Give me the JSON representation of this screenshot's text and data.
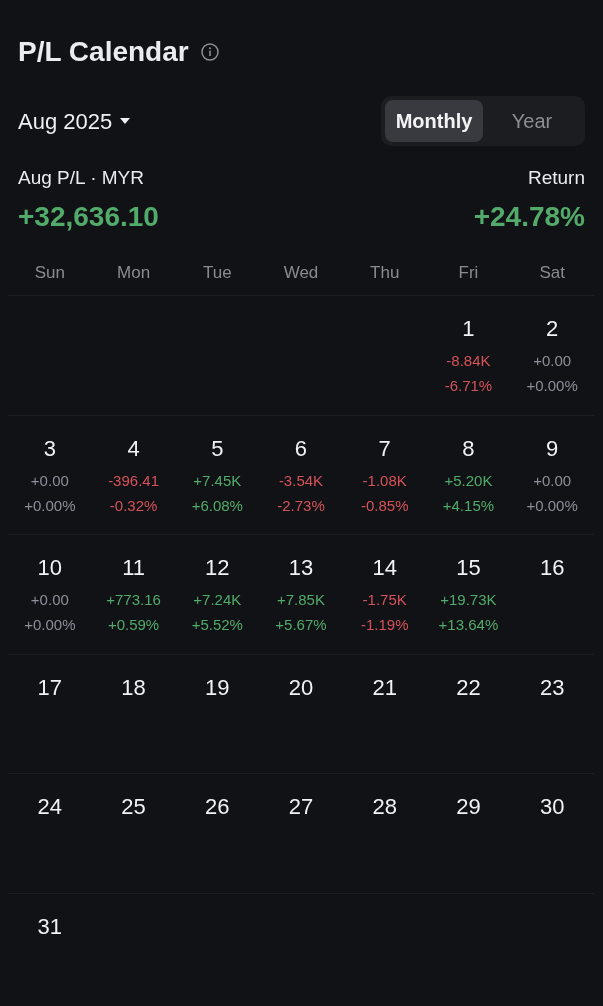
{
  "header": {
    "title": "P/L Calendar"
  },
  "period": {
    "label": "Aug 2025"
  },
  "view_tabs": [
    {
      "label": "Monthly",
      "selected": true
    },
    {
      "label": "Year",
      "selected": false
    }
  ],
  "summary": [
    {
      "label": "Aug P/L · MYR",
      "value": "+32,636.10",
      "color": "#52ab6b"
    },
    {
      "label": "Return",
      "value": "+24.78%",
      "color": "#52ab6b"
    }
  ],
  "weekdays": [
    "Sun",
    "Mon",
    "Tue",
    "Wed",
    "Thu",
    "Fri",
    "Sat"
  ],
  "weeks": [
    {
      "days": [
        {
          "kind": "blank"
        },
        {
          "kind": "blank"
        },
        {
          "kind": "blank"
        },
        {
          "kind": "blank"
        },
        {
          "kind": "blank"
        },
        {
          "kind": "day",
          "day": "1",
          "pl": "-8.84K",
          "return": "-6.71%",
          "color": "#d6525a"
        },
        {
          "kind": "day",
          "day": "2",
          "pl": "+0.00",
          "return": "+0.00%",
          "color": "#8b8f98"
        }
      ]
    },
    {
      "days": [
        {
          "kind": "day",
          "day": "3",
          "pl": "+0.00",
          "return": "+0.00%",
          "color": "#8b8f98"
        },
        {
          "kind": "day",
          "day": "4",
          "pl": "-396.41",
          "return": "-0.32%",
          "color": "#d6525a"
        },
        {
          "kind": "day",
          "day": "5",
          "pl": "+7.45K",
          "return": "+6.08%",
          "color": "#52ab6b"
        },
        {
          "kind": "day",
          "day": "6",
          "pl": "-3.54K",
          "return": "-2.73%",
          "color": "#d6525a"
        },
        {
          "kind": "day",
          "day": "7",
          "pl": "-1.08K",
          "return": "-0.85%",
          "color": "#d6525a"
        },
        {
          "kind": "day",
          "day": "8",
          "pl": "+5.20K",
          "return": "+4.15%",
          "color": "#52ab6b"
        },
        {
          "kind": "day",
          "day": "9",
          "pl": "+0.00",
          "return": "+0.00%",
          "color": "#8b8f98"
        }
      ]
    },
    {
      "days": [
        {
          "kind": "day",
          "day": "10",
          "pl": "+0.00",
          "return": "+0.00%",
          "color": "#8b8f98"
        },
        {
          "kind": "day",
          "day": "11",
          "pl": "+773.16",
          "return": "+0.59%",
          "color": "#52ab6b"
        },
        {
          "kind": "day",
          "day": "12",
          "pl": "+7.24K",
          "return": "+5.52%",
          "color": "#52ab6b"
        },
        {
          "kind": "day",
          "day": "13",
          "pl": "+7.85K",
          "return": "+5.67%",
          "color": "#52ab6b"
        },
        {
          "kind": "day",
          "day": "14",
          "pl": "-1.75K",
          "return": "-1.19%",
          "color": "#d6525a"
        },
        {
          "kind": "day",
          "day": "15",
          "pl": "+19.73K",
          "return": "+13.64%",
          "color": "#52ab6b"
        },
        {
          "kind": "day",
          "day": "16"
        }
      ]
    },
    {
      "days": [
        {
          "kind": "day",
          "day": "17"
        },
        {
          "kind": "day",
          "day": "18"
        },
        {
          "kind": "day",
          "day": "19"
        },
        {
          "kind": "day",
          "day": "20"
        },
        {
          "kind": "day",
          "day": "21"
        },
        {
          "kind": "day",
          "day": "22"
        },
        {
          "kind": "day",
          "day": "23"
        }
      ]
    },
    {
      "days": [
        {
          "kind": "day",
          "day": "24"
        },
        {
          "kind": "day",
          "day": "25"
        },
        {
          "kind": "day",
          "day": "26"
        },
        {
          "kind": "day",
          "day": "27"
        },
        {
          "kind": "day",
          "day": "28"
        },
        {
          "kind": "day",
          "day": "29"
        },
        {
          "kind": "day",
          "day": "30"
        }
      ]
    },
    {
      "days": [
        {
          "kind": "day",
          "day": "31"
        }
      ]
    }
  ]
}
